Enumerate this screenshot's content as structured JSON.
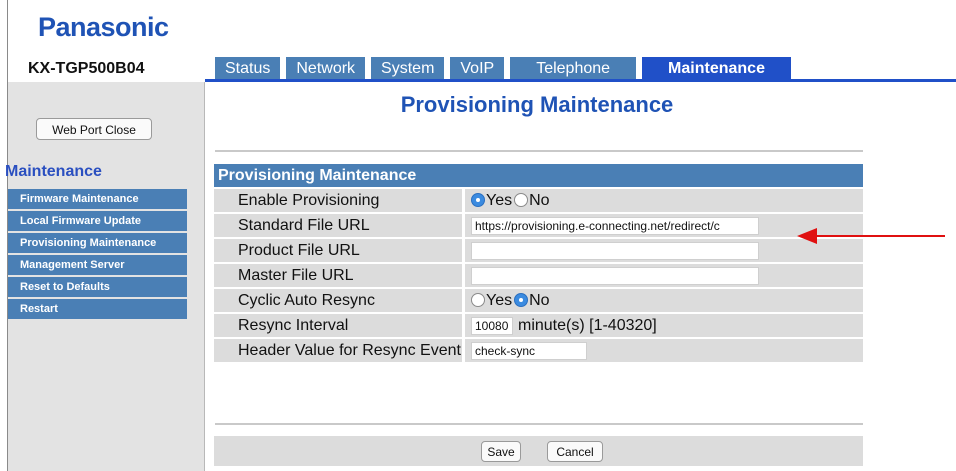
{
  "brand": "Panasonic",
  "model": "KX-TGP500B04",
  "tabs": [
    "Status",
    "Network",
    "System",
    "VoIP",
    "Telephone",
    "Maintenance"
  ],
  "sidebar": {
    "web_port_close": "Web Port Close",
    "title": "Maintenance",
    "items": [
      "Firmware Maintenance",
      "Local Firmware Update",
      "Provisioning Maintenance",
      "Management Server",
      "Reset to Defaults",
      "Restart"
    ]
  },
  "page_title": "Provisioning Maintenance",
  "section_title": "Provisioning Maintenance",
  "fields": {
    "enable_provisioning": {
      "label": "Enable Provisioning",
      "yes": "Yes",
      "no": "No",
      "selected": "Yes"
    },
    "standard_file_url": {
      "label": "Standard File URL",
      "value": "https://provisioning.e-connecting.net/redirect/c"
    },
    "product_file_url": {
      "label": "Product File URL",
      "value": ""
    },
    "master_file_url": {
      "label": "Master File URL",
      "value": ""
    },
    "cyclic_auto_resync": {
      "label": "Cyclic Auto Resync",
      "yes": "Yes",
      "no": "No",
      "selected": "No"
    },
    "resync_interval": {
      "label": "Resync Interval",
      "value": "10080",
      "unit": "minute(s) [1-40320]"
    },
    "header_value": {
      "label": "Header Value for Resync Event",
      "value": "check-sync"
    }
  },
  "buttons": {
    "save": "Save",
    "cancel": "Cancel"
  },
  "colors": {
    "brand": "#1f53b5",
    "tab": "#4a7fb5",
    "tab_active": "#2050c8",
    "arrow": "#e01010"
  }
}
